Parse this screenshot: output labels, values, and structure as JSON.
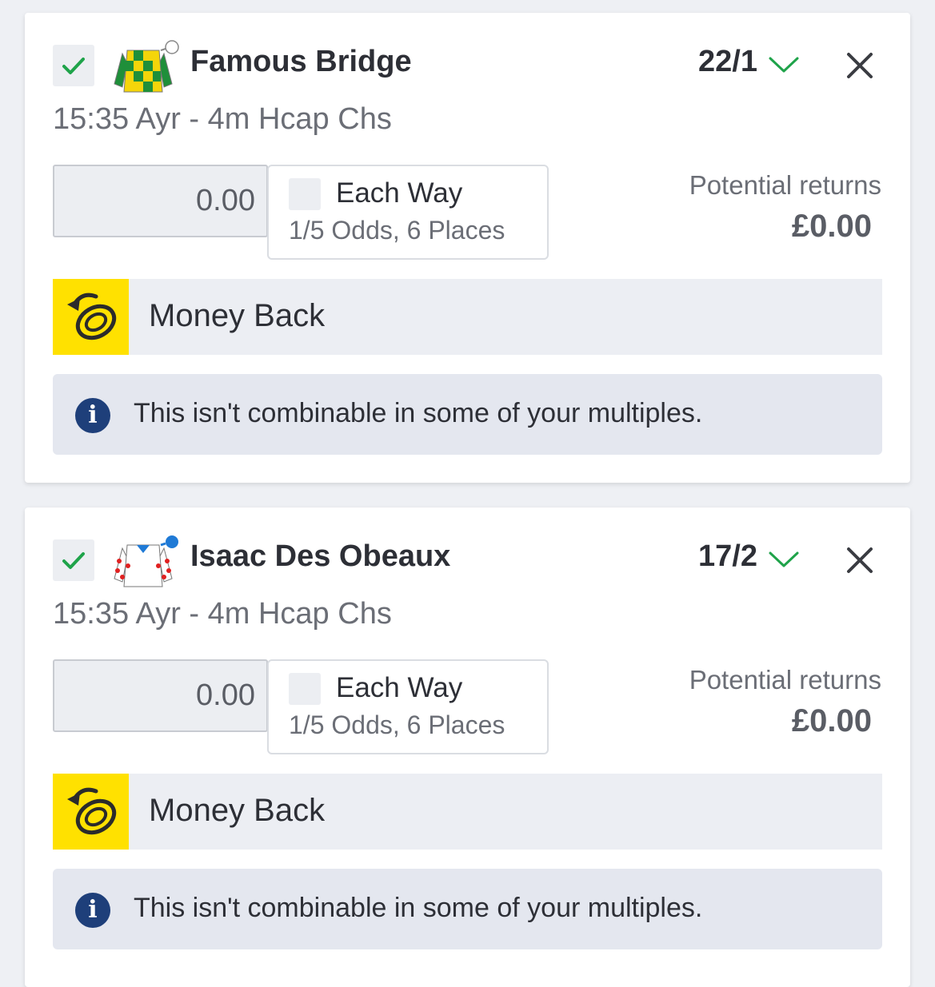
{
  "bets": [
    {
      "runner": "Famous Bridge",
      "odds": "22/1",
      "race": "15:35 Ayr - 4m Hcap Chs",
      "stake_placeholder": "0.00",
      "each_way_label": "Each Way",
      "each_way_terms": "1/5 Odds, 6 Places",
      "returns_label": "Potential returns",
      "returns_value": "£0.00",
      "money_back_label": "Money Back",
      "info_text": "This isn't combinable in some of your multiples.",
      "silks_colors": [
        "#f5d50a",
        "#1f8f3a"
      ],
      "cap_color": "#ffffff",
      "silks_icon": "jockey-silks-green-yellow-check"
    },
    {
      "runner": "Isaac Des Obeaux",
      "odds": "17/2",
      "race": "15:35 Ayr - 4m Hcap Chs",
      "stake_placeholder": "0.00",
      "each_way_label": "Each Way",
      "each_way_terms": "1/5 Odds, 6 Places",
      "returns_label": "Potential returns",
      "returns_value": "£0.00",
      "money_back_label": "Money Back",
      "info_text": "This isn't combinable in some of your multiples.",
      "silks_colors": [
        "#ffffff",
        "#e02020"
      ],
      "cap_color": "#1f7ad6",
      "silks_icon": "jockey-silks-white-red-spots"
    }
  ],
  "colors": {
    "accent_green": "#1fa34a",
    "money_back_yellow": "#ffe100",
    "info_blue": "#1e3f7a"
  },
  "icons": {
    "selected": "checkmark-icon",
    "odds_dropdown": "chevron-down-icon",
    "remove": "close-icon",
    "money_back": "money-back-coin-icon",
    "info": "info-icon"
  }
}
